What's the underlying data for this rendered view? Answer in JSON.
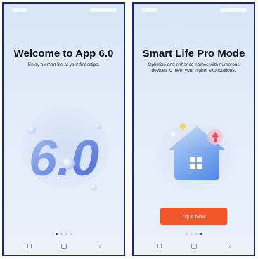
{
  "screens": [
    {
      "title": "Welcome to App 6.0",
      "subtitle": "Enjoy a smart life at your fingertips.",
      "illustration_text": "6.0",
      "pager": {
        "count": 4,
        "active": 1
      }
    },
    {
      "title": "Smart Life Pro Mode",
      "subtitle": "Optimize and enhance homes with numerous devices to meet your higher expectations.",
      "button_label": "Try It Now",
      "pager": {
        "count": 4,
        "active": 4
      }
    }
  ],
  "colors": {
    "accent_button": "#f2562b",
    "frame_border": "#1b2a6b",
    "background": "#e3edf9"
  },
  "icons": {
    "nav_recent": "recent-apps-icon",
    "nav_home": "home-icon",
    "nav_back": "back-icon",
    "house": "house-icon"
  }
}
